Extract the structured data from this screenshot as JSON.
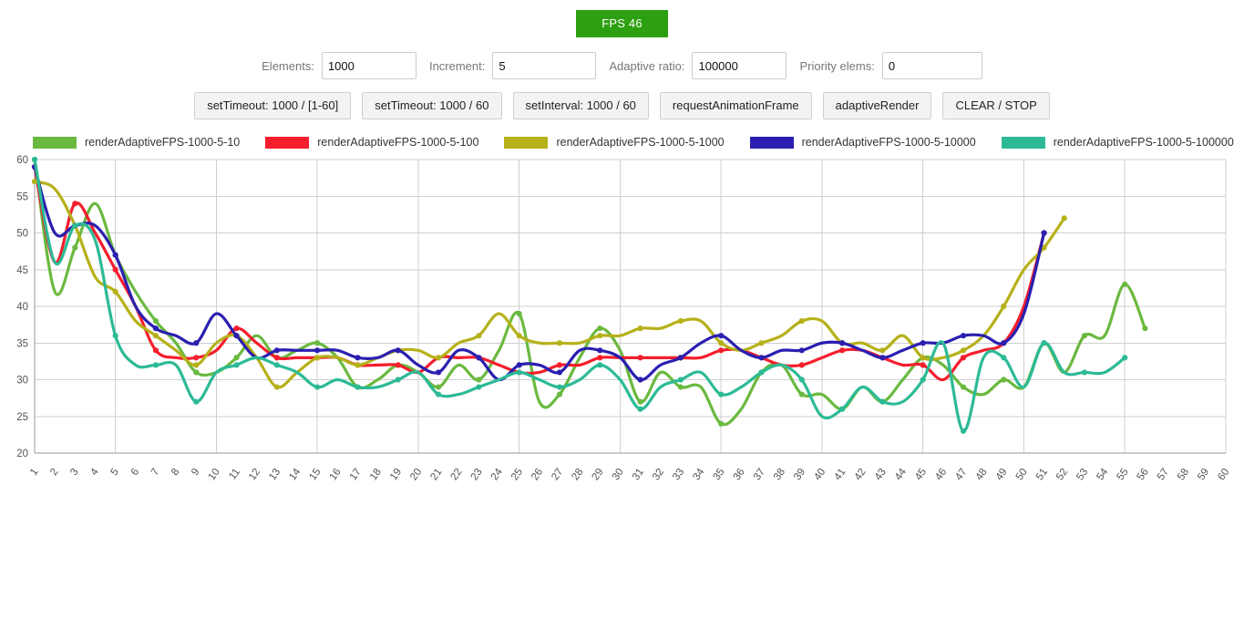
{
  "fps": {
    "label": "FPS 46"
  },
  "params": [
    {
      "name": "elements",
      "label": "Elements:",
      "value": "1000",
      "placeholder": ""
    },
    {
      "name": "increment",
      "label": "Increment:",
      "value": "5",
      "placeholder": ""
    },
    {
      "name": "ratio",
      "label": "Adaptive ratio:",
      "value": "100000",
      "placeholder": ""
    },
    {
      "name": "priority",
      "label": "Priority elems:",
      "value": "0",
      "placeholder": ""
    }
  ],
  "buttons": [
    {
      "name": "settimeout-range",
      "label": "setTimeout: 1000 / [1-60]"
    },
    {
      "name": "settimeout-60",
      "label": "setTimeout: 1000 / 60"
    },
    {
      "name": "setinterval-60",
      "label": "setInterval: 1000 / 60"
    },
    {
      "name": "request-animation-frame",
      "label": "requestAnimationFrame"
    },
    {
      "name": "adaptive-render",
      "label": "adaptiveRender"
    },
    {
      "name": "clear-stop",
      "label": "CLEAR / STOP"
    }
  ],
  "colors": {
    "green": "#6ab93f",
    "red": "#f41e2d",
    "olive": "#b5b119",
    "blue": "#2a1fb0",
    "teal": "#2cba96",
    "grid": "#cfcfcf",
    "axis": "#9a9a9a",
    "badge": "#2ca010"
  },
  "chart_data": {
    "type": "line",
    "title": "",
    "xlabel": "",
    "ylabel": "",
    "xlim": [
      1,
      60
    ],
    "ylim": [
      20,
      60
    ],
    "yticks": [
      20,
      25,
      30,
      35,
      40,
      45,
      50,
      55,
      60
    ],
    "xticks": [
      1,
      2,
      3,
      4,
      5,
      6,
      7,
      8,
      9,
      10,
      11,
      12,
      13,
      14,
      15,
      16,
      17,
      18,
      19,
      20,
      21,
      22,
      23,
      24,
      25,
      26,
      27,
      28,
      29,
      30,
      31,
      32,
      33,
      34,
      35,
      36,
      37,
      38,
      39,
      40,
      41,
      42,
      43,
      44,
      45,
      46,
      47,
      48,
      49,
      50,
      51,
      52,
      53,
      54,
      55,
      56,
      57,
      58,
      59,
      60
    ],
    "grid": true,
    "legend_position": "top-left",
    "smoothing": "spline",
    "markers": true,
    "series": [
      {
        "name": "renderAdaptiveFPS-1000-5-10",
        "color": "#6ab93f",
        "x": [
          1,
          2,
          3,
          4,
          5,
          6,
          7,
          8,
          9,
          10,
          11,
          12,
          13,
          14,
          15,
          16,
          17,
          18,
          19,
          20,
          21,
          22,
          23,
          24,
          25,
          26,
          27,
          28,
          29,
          30,
          31,
          32,
          33,
          34,
          35,
          36,
          37,
          38,
          39,
          40,
          41,
          42,
          43,
          44,
          45,
          46,
          47,
          48,
          49,
          50,
          51,
          52,
          53,
          54,
          55,
          56
        ],
        "values": [
          60,
          42,
          48,
          54,
          47,
          42,
          38,
          35,
          31,
          31,
          33,
          36,
          33,
          34,
          35,
          33,
          29,
          30,
          32,
          31,
          29,
          32,
          30,
          34,
          39,
          27,
          28,
          33,
          37,
          34,
          27,
          31,
          29,
          29,
          24,
          26,
          31,
          32,
          28,
          28,
          26,
          29,
          27,
          30,
          33,
          32,
          29,
          28,
          30,
          29,
          35,
          31,
          36,
          36,
          43,
          37
        ]
      },
      {
        "name": "renderAdaptiveFPS-1000-5-100",
        "color": "#f41e2d",
        "x": [
          1,
          2,
          3,
          4,
          5,
          6,
          7,
          8,
          9,
          10,
          11,
          12,
          13,
          14,
          15,
          16,
          17,
          18,
          19,
          20,
          21,
          22,
          23,
          24,
          25,
          26,
          27,
          28,
          29,
          30,
          31,
          32,
          33,
          34,
          35,
          36,
          37,
          38,
          39,
          40,
          41,
          42,
          43,
          44,
          45,
          46,
          47,
          48,
          49,
          50,
          51
        ],
        "values": [
          59,
          46,
          54,
          50,
          45,
          40,
          34,
          33,
          33,
          34,
          37,
          35,
          33,
          33,
          33,
          33,
          32,
          32,
          32,
          31,
          33,
          33,
          33,
          32,
          31,
          31,
          32,
          32,
          33,
          33,
          33,
          33,
          33,
          33,
          34,
          34,
          33,
          32,
          32,
          33,
          34,
          34,
          33,
          32,
          32,
          30,
          33,
          34,
          35,
          40,
          50
        ]
      },
      {
        "name": "renderAdaptiveFPS-1000-5-1000",
        "color": "#b5b119",
        "x": [
          1,
          2,
          3,
          4,
          5,
          6,
          7,
          8,
          9,
          10,
          11,
          12,
          13,
          14,
          15,
          16,
          17,
          18,
          19,
          20,
          21,
          22,
          23,
          24,
          25,
          26,
          27,
          28,
          29,
          30,
          31,
          32,
          33,
          34,
          35,
          36,
          37,
          38,
          39,
          40,
          41,
          42,
          43,
          44,
          45,
          46,
          47,
          48,
          49,
          50,
          51,
          52
        ],
        "values": [
          57,
          56,
          51,
          44,
          42,
          38,
          36,
          34,
          32,
          35,
          36,
          33,
          29,
          31,
          33,
          33,
          32,
          33,
          34,
          34,
          33,
          35,
          36,
          39,
          36,
          35,
          35,
          35,
          36,
          36,
          37,
          37,
          38,
          38,
          35,
          34,
          35,
          36,
          38,
          38,
          35,
          35,
          34,
          36,
          33,
          33,
          34,
          36,
          40,
          45,
          48,
          52
        ]
      },
      {
        "name": "renderAdaptiveFPS-1000-5-10000",
        "color": "#2a1fb0",
        "x": [
          1,
          2,
          3,
          4,
          5,
          6,
          7,
          8,
          9,
          10,
          11,
          12,
          13,
          14,
          15,
          16,
          17,
          18,
          19,
          20,
          21,
          22,
          23,
          24,
          25,
          26,
          27,
          28,
          29,
          30,
          31,
          32,
          33,
          34,
          35,
          36,
          37,
          38,
          39,
          40,
          41,
          42,
          43,
          44,
          45,
          46,
          47,
          48,
          49,
          50,
          51
        ],
        "values": [
          59,
          50,
          51,
          51,
          47,
          40,
          37,
          36,
          35,
          39,
          36,
          33,
          34,
          34,
          34,
          34,
          33,
          33,
          34,
          32,
          31,
          34,
          33,
          30,
          32,
          32,
          31,
          34,
          34,
          33,
          30,
          32,
          33,
          35,
          36,
          34,
          33,
          34,
          34,
          35,
          35,
          34,
          33,
          34,
          35,
          35,
          36,
          36,
          35,
          39,
          50
        ]
      },
      {
        "name": "renderAdaptiveFPS-1000-5-100000",
        "color": "#2cba96",
        "x": [
          1,
          2,
          3,
          4,
          5,
          6,
          7,
          8,
          9,
          10,
          11,
          12,
          13,
          14,
          15,
          16,
          17,
          18,
          19,
          20,
          21,
          22,
          23,
          24,
          25,
          26,
          27,
          28,
          29,
          30,
          31,
          32,
          33,
          34,
          35,
          36,
          37,
          38,
          39,
          40,
          41,
          42,
          43,
          44,
          45,
          46,
          47,
          48,
          49,
          50,
          51,
          52,
          53,
          54,
          55
        ],
        "values": [
          60,
          46,
          51,
          49,
          36,
          32,
          32,
          32,
          27,
          31,
          32,
          33,
          32,
          31,
          29,
          30,
          29,
          29,
          30,
          31,
          28,
          28,
          29,
          30,
          31,
          30,
          29,
          30,
          32,
          30,
          26,
          29,
          30,
          31,
          28,
          29,
          31,
          32,
          30,
          25,
          26,
          29,
          27,
          27,
          30,
          35,
          23,
          33,
          33,
          29,
          35,
          31,
          31,
          31,
          33
        ]
      }
    ]
  }
}
